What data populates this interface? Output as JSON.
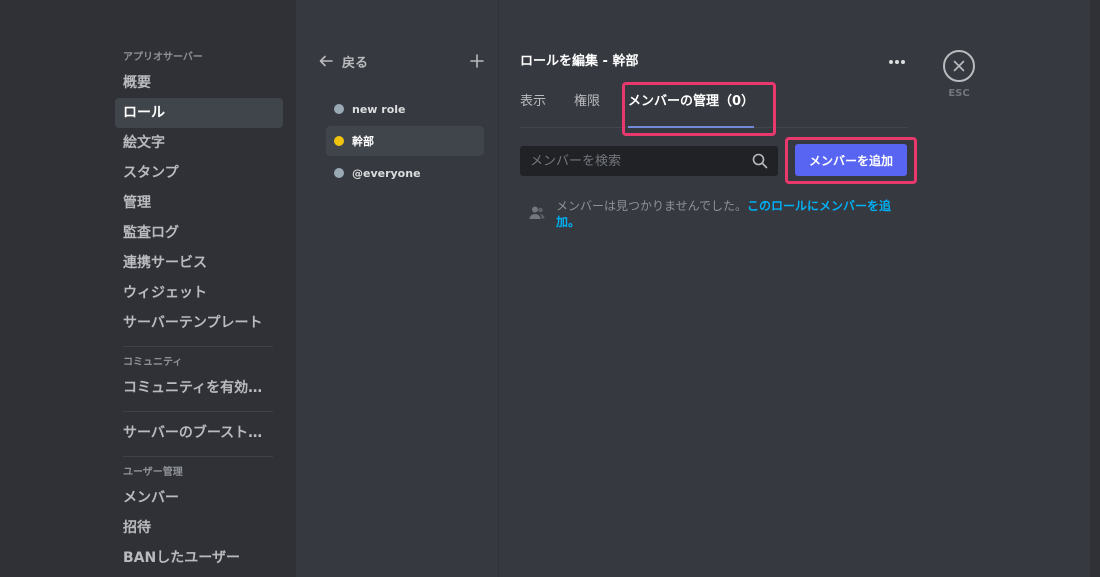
{
  "sidebar": {
    "sections": [
      {
        "header": "アプリオサーバー",
        "items": [
          {
            "label": "概要",
            "active": false
          },
          {
            "label": "ロール",
            "active": true
          },
          {
            "label": "絵文字",
            "active": false
          },
          {
            "label": "スタンプ",
            "active": false
          },
          {
            "label": "管理",
            "active": false
          },
          {
            "label": "監査ログ",
            "active": false
          },
          {
            "label": "連携サービス",
            "active": false
          },
          {
            "label": "ウィジェット",
            "active": false
          },
          {
            "label": "サーバーテンプレート",
            "active": false
          }
        ]
      },
      {
        "header": "コミュニティ",
        "items": [
          {
            "label": "コミュニティを有効に...",
            "active": false
          }
        ]
      },
      {
        "header": "",
        "items": [
          {
            "label": "サーバーのブースト状態",
            "active": false
          }
        ]
      },
      {
        "header": "ユーザー管理",
        "items": [
          {
            "label": "メンバー",
            "active": false
          },
          {
            "label": "招待",
            "active": false
          },
          {
            "label": "BANしたユーザー",
            "active": false
          }
        ]
      }
    ]
  },
  "roles": {
    "back_label": "戻る",
    "add_icon": "plus-icon",
    "items": [
      {
        "label": "new role",
        "color": "#99aab5",
        "active": false
      },
      {
        "label": "幹部",
        "color": "#f1c40f",
        "active": true
      },
      {
        "label": "@everyone",
        "color": "#99aab5",
        "active": false
      }
    ]
  },
  "main": {
    "title": "ロールを編集 - 幹部",
    "more_icon": "more-horizontal-icon",
    "tabs": [
      {
        "label": "表示",
        "active": false
      },
      {
        "label": "権限",
        "active": false
      },
      {
        "label": "メンバーの管理（0）",
        "active": true
      }
    ],
    "search_placeholder": "メンバーを検索",
    "search_value": "",
    "add_button": "メンバーを追加",
    "empty_text": "メンバーは見つかりませんでした。",
    "empty_link": "このロールにメンバーを追加。"
  },
  "close": {
    "label": "ESC"
  },
  "colors": {
    "accent": "#5865f2",
    "link": "#00b0f4",
    "highlight": "#e8386d"
  }
}
